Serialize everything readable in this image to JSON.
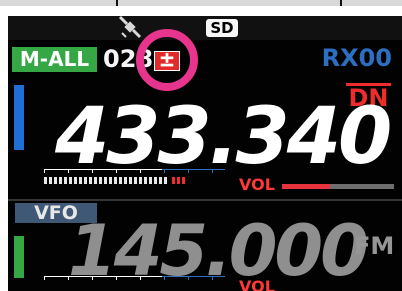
{
  "status": {
    "sd_label": "SD"
  },
  "upper_band": {
    "mode": "M-ALL",
    "memory_channel": "028",
    "rx_label": "RX00",
    "dn_label": "DN",
    "frequency": "433.340",
    "vol_label": "VOL"
  },
  "lower_band": {
    "mode": "VFO",
    "frequency": "145.000",
    "modulation": "FM",
    "vol_label": "VOL"
  },
  "icons": {
    "satellite": "satellite-icon",
    "shift": "shift-plus-minus-icon"
  },
  "colors": {
    "background": "#020202",
    "mode_all": "#35a845",
    "rx": "#2c6fc2",
    "dn": "#ee2c2c",
    "vol": "#ff3838",
    "highlight_ring": "#e7348c",
    "vfo": "#3e5876"
  }
}
